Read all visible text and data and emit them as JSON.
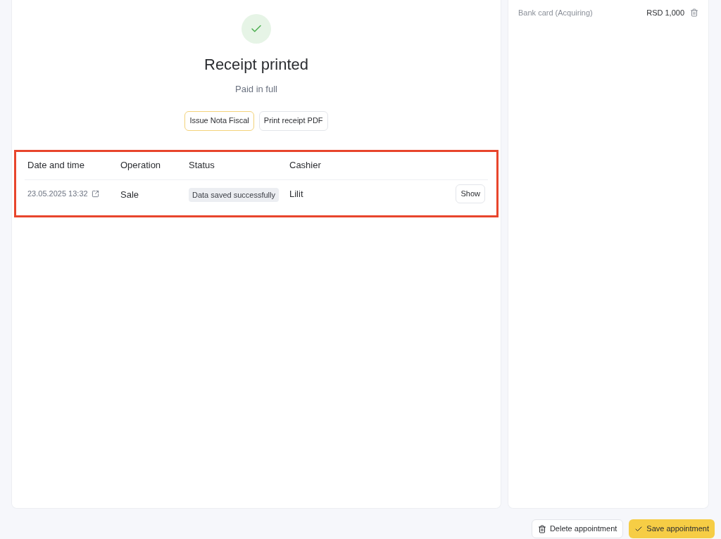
{
  "result": {
    "title": "Receipt printed",
    "subtitle": "Paid in full",
    "actions": [
      {
        "label": "Issue Nota Fiscal",
        "kind": "primary"
      },
      {
        "label": "Print receipt PDF",
        "kind": "secondary"
      }
    ]
  },
  "operations_table": {
    "columns": [
      "Date and time",
      "Operation",
      "Status",
      "Cashier"
    ],
    "rows": [
      {
        "date": "23.05.2025 13:32",
        "operation": "Sale",
        "status": "Data saved successfully",
        "cashier": "Lilit",
        "action": "Show"
      }
    ]
  },
  "payments": [
    {
      "method": "Bank card (Acquiring)",
      "amount": "RSD 1,000"
    }
  ],
  "footer": {
    "delete": "Delete appointment",
    "save": "Save appointment"
  }
}
